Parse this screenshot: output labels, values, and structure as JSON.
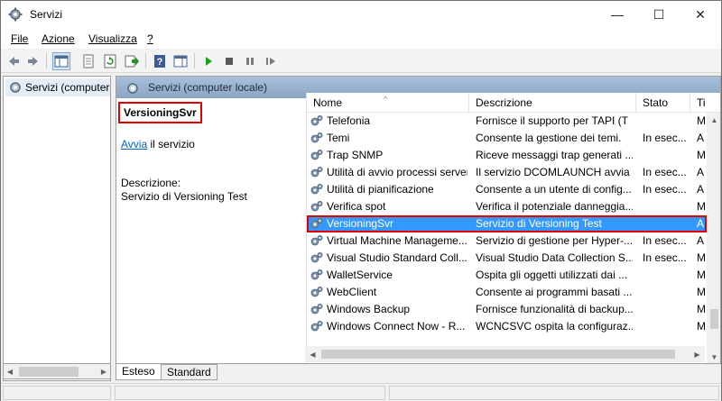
{
  "window": {
    "title": "Servizi",
    "minimize": "—",
    "maximize": "☐",
    "close": "✕"
  },
  "menu": [
    {
      "label": "File",
      "underline": "F"
    },
    {
      "label": "Azione",
      "underline": "A"
    },
    {
      "label": "Visualizza",
      "underline": "V"
    },
    {
      "label": "?",
      "underline": "?"
    }
  ],
  "toolbar": {
    "icons": [
      "back-arrow-icon",
      "forward-arrow-icon",
      "show-console-tree-icon",
      "properties-icon",
      "refresh-icon",
      "export-list-icon",
      "help-icon",
      "show-hide-action-pane-icon",
      "start-service-icon",
      "stop-service-icon",
      "pause-service-icon",
      "restart-service-icon"
    ]
  },
  "tree": {
    "root_label": "Servizi (computer locale)"
  },
  "pane": {
    "header": "Servizi (computer locale)"
  },
  "extended": {
    "service_name": "VersioningSvr",
    "start_link": "Avvia",
    "start_suffix": " il servizio",
    "description_label": "Descrizione:",
    "description_text": "Servizio di Versioning Test"
  },
  "columns": {
    "name": "Nome",
    "description": "Descrizione",
    "state": "Stato",
    "type": "Ti"
  },
  "services": [
    {
      "name": "Telefonia",
      "description": "Fornisce il supporto per TAPI (T",
      "state": "",
      "type": "M"
    },
    {
      "name": "Temi",
      "description": "Consente la gestione dei temi.",
      "state": "In esec...",
      "type": "A"
    },
    {
      "name": "Trap SNMP",
      "description": "Riceve messaggi trap generati ...",
      "state": "",
      "type": "M"
    },
    {
      "name": "Utilità di avvio processi server...",
      "description": "Il servizio DCOMLAUNCH avvia ...",
      "state": "In esec...",
      "type": "A"
    },
    {
      "name": "Utilità di pianificazione",
      "description": "Consente a un utente di config...",
      "state": "In esec...",
      "type": "A"
    },
    {
      "name": "Verifica spot",
      "description": "Verifica il potenziale danneggia...",
      "state": "",
      "type": "M"
    },
    {
      "name": "VersioningSvr",
      "description": "Servizio di Versioning Test",
      "state": "",
      "type": "A",
      "selected": true
    },
    {
      "name": "Virtual Machine Manageme...",
      "description": "Servizio di gestione per Hyper-...",
      "state": "In esec...",
      "type": "A"
    },
    {
      "name": "Visual Studio Standard Coll...",
      "description": "Visual Studio Data Collection S...",
      "state": "In esec...",
      "type": "M"
    },
    {
      "name": "WalletService",
      "description": "Ospita gli oggetti utilizzati dai ...",
      "state": "",
      "type": "M"
    },
    {
      "name": "WebClient",
      "description": "Consente ai programmi basati ...",
      "state": "",
      "type": "M"
    },
    {
      "name": "Windows Backup",
      "description": "Fornisce funzionalità di backup...",
      "state": "",
      "type": "M"
    },
    {
      "name": "Windows Connect Now - R...",
      "description": "WCNCSVC ospita la configuraz...",
      "state": "",
      "type": "M"
    }
  ],
  "tabs": [
    {
      "label": "Esteso",
      "active": true
    },
    {
      "label": "Standard",
      "active": false
    }
  ]
}
